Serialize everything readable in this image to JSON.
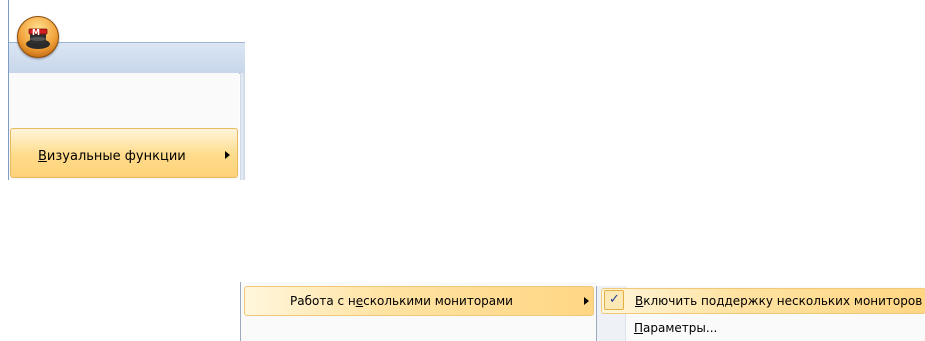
{
  "app": {
    "orb_letter": "M"
  },
  "menu": {
    "visual_functions": {
      "accel": "В",
      "rest": "изуальные функции"
    },
    "multi_monitor": {
      "before": "Работа с н",
      "accel": "е",
      "after": "сколькими мониторами"
    },
    "enable_multi_monitor": {
      "accel": "В",
      "rest": "ключить поддержку нескольких мониторов",
      "checked": true,
      "check_glyph": "✓"
    },
    "parameters": {
      "accel": "П",
      "rest": "араметры..."
    }
  },
  "colors": {
    "highlight": "#ffd684",
    "highlight_border": "#e8b95f",
    "menu_bg": "#fafafa",
    "titlebar": "#c7d6ea",
    "check": "#1f3f9a"
  }
}
